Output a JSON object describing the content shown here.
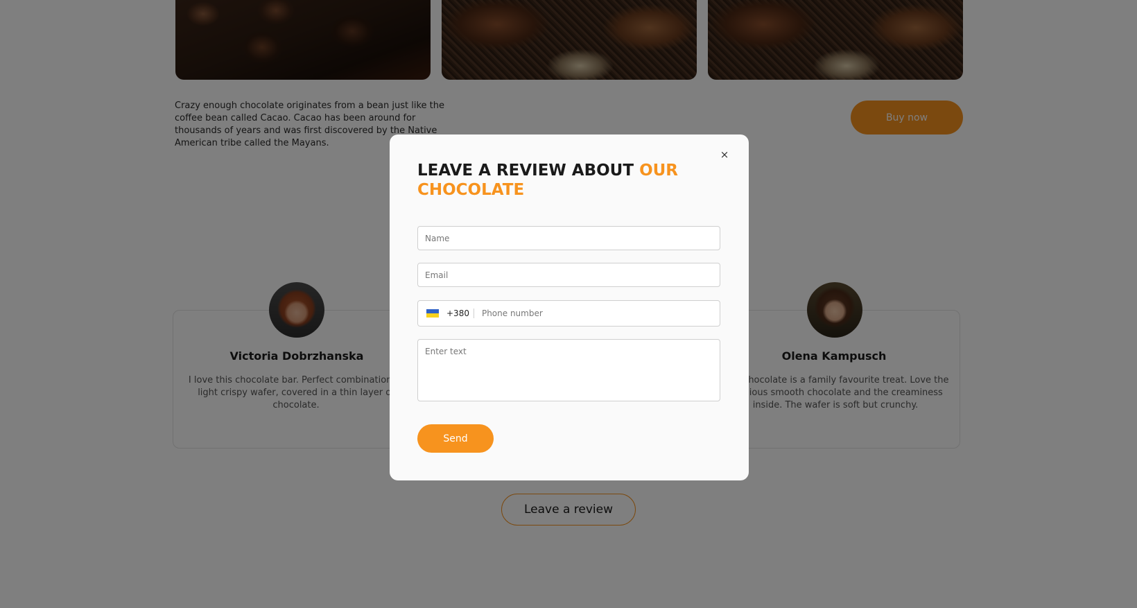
{
  "products": {
    "description": "Crazy enough chocolate originates from a bean just like the coffee bean called Cacao. Cacao has been around for thousands of years and was first discovered by the Native American tribe called the Mayans.",
    "buy_label": "Buy now"
  },
  "reviews": [
    {
      "name": "Victoria Dobrzhanska",
      "text": "I love this chocolate bar. Perfect combination of light crispy wafer, covered in a thin layer of chocolate."
    },
    {
      "name": "Olena Kampusch",
      "text": "This chocolate is a family favourite treat. Love the delicious smooth chocolate and the creaminess inside. The wafer is soft but crunchy."
    }
  ],
  "leave_review_label": "Leave a review",
  "modal": {
    "close_label": "×",
    "title_main": "LEAVE A REVIEW ABOUT ",
    "title_accent": "OUR CHOCOLATE",
    "name_placeholder": "Name",
    "email_placeholder": "Email",
    "phone_code": "+380",
    "phone_placeholder": "Phone number",
    "text_placeholder": "Enter text",
    "send_label": "Send"
  },
  "colors": {
    "accent": "#f7931e",
    "overlay": "rgba(0,0,0,0.5)"
  },
  "icons": {
    "close": "close-icon",
    "flag": "ukraine-flag-icon"
  }
}
